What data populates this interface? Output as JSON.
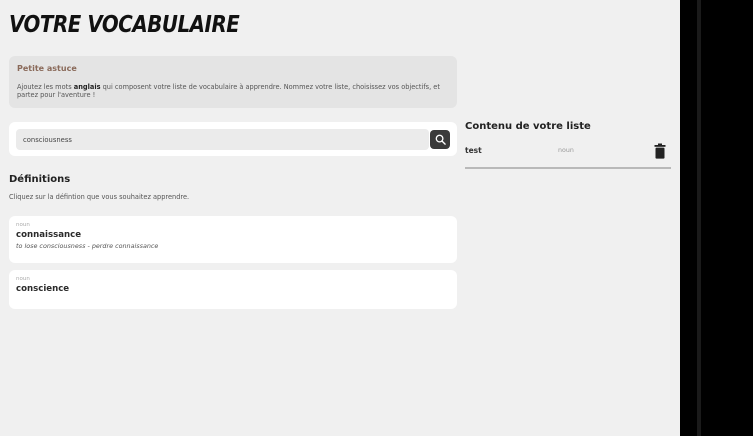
{
  "header": {
    "title": "VOTRE VOCABULAIRE"
  },
  "tip": {
    "title": "Petite astuce",
    "text_before": "Ajoutez les mots ",
    "text_bold": "anglais",
    "text_after": " qui composent votre liste de vocabulaire à apprendre. Nommez votre liste, choisissez vos objectifs, et partez pour l'aventure !"
  },
  "search": {
    "value": "consciousness",
    "icon": "search-icon"
  },
  "definitions": {
    "title": "Définitions",
    "subtitle": "Cliquez sur la défintion que vous souhaitez apprendre.",
    "items": [
      {
        "pos": "noun",
        "word": "connaissance",
        "example": "to lose consciousness - perdre connaissance"
      },
      {
        "pos": "noun",
        "word": "conscience",
        "example": ""
      }
    ]
  },
  "list": {
    "title": "Contenu de votre liste",
    "items": [
      {
        "word": "test",
        "pos": "noun",
        "icon": "trash-icon"
      }
    ]
  }
}
